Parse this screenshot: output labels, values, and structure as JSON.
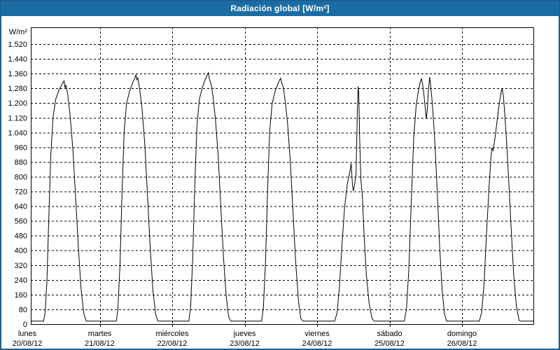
{
  "colors": {
    "title_bar_bg": "#1B6CA4",
    "panel_border": "#1D5F92",
    "title_text": "#FFFFFF",
    "plot_background": "#FFFFFF",
    "grid_color": "#000000",
    "line_color": "#000000",
    "text_color": "#000000"
  },
  "chart_data": {
    "type": "line",
    "title": "Radiación global [W/m²]",
    "unit_label": "W/m²",
    "series_name": "Radiación global",
    "ylabel": "W/m²",
    "xlabel": "",
    "ylim": [
      0,
      1520
    ],
    "ytick_step": 80,
    "grid": "on",
    "legend": "none",
    "y_tick_labels": [
      "0",
      "80",
      "160",
      "240",
      "320",
      "400",
      "480",
      "560",
      "640",
      "720",
      "800",
      "880",
      "960",
      "1.040",
      "1.120",
      "1.200",
      "1.280",
      "1.360",
      "1.440",
      "1.520"
    ],
    "x_range_days": 7,
    "night_baseline_w_m2": 16,
    "days": [
      {
        "name": "lunes",
        "date": "20/08/12",
        "peak_w_m2": 1320,
        "points": [
          [
            0,
            16
          ],
          [
            5.4,
            16
          ],
          [
            5.9,
            60
          ],
          [
            6.5,
            230
          ],
          [
            7.1,
            560
          ],
          [
            7.8,
            920
          ],
          [
            8.5,
            1120
          ],
          [
            9.4,
            1220
          ],
          [
            10.5,
            1270
          ],
          [
            11.6,
            1305
          ],
          [
            12.2,
            1320
          ],
          [
            12.5,
            1282
          ],
          [
            12.8,
            1298
          ],
          [
            13.4,
            1245
          ],
          [
            14.2,
            1130
          ],
          [
            15.1,
            950
          ],
          [
            16.0,
            690
          ],
          [
            16.9,
            420
          ],
          [
            17.8,
            190
          ],
          [
            18.7,
            60
          ],
          [
            19.5,
            16
          ],
          [
            24,
            16
          ]
        ]
      },
      {
        "name": "martes",
        "date": "21/08/12",
        "peak_w_m2": 1355,
        "points": [
          [
            0,
            16
          ],
          [
            5.5,
            16
          ],
          [
            6.0,
            80
          ],
          [
            6.7,
            320
          ],
          [
            7.4,
            720
          ],
          [
            8.1,
            1050
          ],
          [
            8.9,
            1200
          ],
          [
            9.9,
            1265
          ],
          [
            10.9,
            1310
          ],
          [
            11.7,
            1340
          ],
          [
            12.0,
            1355
          ],
          [
            12.3,
            1327
          ],
          [
            12.6,
            1337
          ],
          [
            13.2,
            1280
          ],
          [
            14.0,
            1170
          ],
          [
            14.9,
            980
          ],
          [
            15.8,
            710
          ],
          [
            16.7,
            420
          ],
          [
            17.6,
            185
          ],
          [
            18.5,
            55
          ],
          [
            19.3,
            16
          ],
          [
            24,
            16
          ]
        ]
      },
      {
        "name": "miércoles",
        "date": "22/08/12",
        "peak_w_m2": 1365,
        "points": [
          [
            0,
            16
          ],
          [
            5.5,
            16
          ],
          [
            6.1,
            90
          ],
          [
            6.8,
            360
          ],
          [
            7.5,
            760
          ],
          [
            8.2,
            1080
          ],
          [
            9.0,
            1220
          ],
          [
            10.0,
            1285
          ],
          [
            11.0,
            1330
          ],
          [
            11.7,
            1355
          ],
          [
            12.0,
            1365
          ],
          [
            12.3,
            1332
          ],
          [
            12.9,
            1302
          ],
          [
            13.5,
            1240
          ],
          [
            14.3,
            1115
          ],
          [
            15.2,
            920
          ],
          [
            16.1,
            640
          ],
          [
            17.0,
            360
          ],
          [
            17.9,
            150
          ],
          [
            18.7,
            40
          ],
          [
            19.4,
            16
          ],
          [
            24,
            16
          ]
        ]
      },
      {
        "name": "jueves",
        "date": "23/08/12",
        "peak_w_m2": 1335,
        "points": [
          [
            0,
            16
          ],
          [
            5.6,
            16
          ],
          [
            6.2,
            85
          ],
          [
            6.9,
            340
          ],
          [
            7.6,
            730
          ],
          [
            8.3,
            1050
          ],
          [
            9.1,
            1195
          ],
          [
            10.1,
            1265
          ],
          [
            11.1,
            1308
          ],
          [
            11.9,
            1335
          ],
          [
            12.3,
            1308
          ],
          [
            12.8,
            1288
          ],
          [
            13.4,
            1215
          ],
          [
            14.2,
            1095
          ],
          [
            15.1,
            890
          ],
          [
            16.0,
            615
          ],
          [
            16.9,
            335
          ],
          [
            17.8,
            130
          ],
          [
            18.6,
            30
          ],
          [
            19.3,
            16
          ],
          [
            24,
            16
          ]
        ]
      },
      {
        "name": "viernes",
        "date": "24/08/12",
        "peak_w_m2": 1290,
        "points": [
          [
            0,
            16
          ],
          [
            5.8,
            16
          ],
          [
            6.6,
            60
          ],
          [
            7.4,
            200
          ],
          [
            8.2,
            420
          ],
          [
            9.1,
            630
          ],
          [
            10.0,
            760
          ],
          [
            10.9,
            830
          ],
          [
            11.3,
            872
          ],
          [
            11.7,
            758
          ],
          [
            12.0,
            722
          ],
          [
            12.5,
            765
          ],
          [
            12.9,
            810
          ],
          [
            13.3,
            1140
          ],
          [
            13.6,
            1290
          ],
          [
            13.8,
            1255
          ],
          [
            14.1,
            1010
          ],
          [
            14.5,
            788
          ],
          [
            15.0,
            690
          ],
          [
            15.6,
            470
          ],
          [
            16.3,
            270
          ],
          [
            17.2,
            115
          ],
          [
            18.2,
            30
          ],
          [
            19.0,
            16
          ],
          [
            24,
            16
          ]
        ]
      },
      {
        "name": "sábado",
        "date": "25/08/12",
        "peak_w_m2": 1341,
        "points": [
          [
            0,
            16
          ],
          [
            4.9,
            16
          ],
          [
            5.6,
            80
          ],
          [
            6.4,
            300
          ],
          [
            7.2,
            660
          ],
          [
            8.0,
            1010
          ],
          [
            8.8,
            1185
          ],
          [
            9.6,
            1272
          ],
          [
            10.3,
            1322
          ],
          [
            10.6,
            1332
          ],
          [
            11.0,
            1298
          ],
          [
            11.5,
            1228
          ],
          [
            12.0,
            1140
          ],
          [
            12.2,
            1113
          ],
          [
            12.5,
            1165
          ],
          [
            12.9,
            1275
          ],
          [
            13.3,
            1341
          ],
          [
            13.6,
            1296
          ],
          [
            14.0,
            1228
          ],
          [
            14.6,
            1095
          ],
          [
            15.2,
            930
          ],
          [
            15.9,
            680
          ],
          [
            16.6,
            420
          ],
          [
            17.4,
            190
          ],
          [
            18.2,
            55
          ],
          [
            18.9,
            16
          ],
          [
            24,
            16
          ]
        ]
      },
      {
        "name": "domingo",
        "date": "26/08/12",
        "peak_w_m2": 1280,
        "points": [
          [
            0,
            16
          ],
          [
            5.7,
            16
          ],
          [
            6.5,
            60
          ],
          [
            7.3,
            220
          ],
          [
            8.1,
            480
          ],
          [
            8.9,
            730
          ],
          [
            9.6,
            905
          ],
          [
            9.9,
            958
          ],
          [
            10.3,
            942
          ],
          [
            10.9,
            1005
          ],
          [
            11.6,
            1100
          ],
          [
            12.4,
            1205
          ],
          [
            13.0,
            1262
          ],
          [
            13.3,
            1280
          ],
          [
            13.7,
            1238
          ],
          [
            14.2,
            1135
          ],
          [
            14.8,
            985
          ],
          [
            15.5,
            775
          ],
          [
            16.3,
            515
          ],
          [
            17.1,
            275
          ],
          [
            18.0,
            100
          ],
          [
            18.9,
            20
          ],
          [
            19.6,
            16
          ],
          [
            24,
            16
          ]
        ]
      }
    ]
  }
}
